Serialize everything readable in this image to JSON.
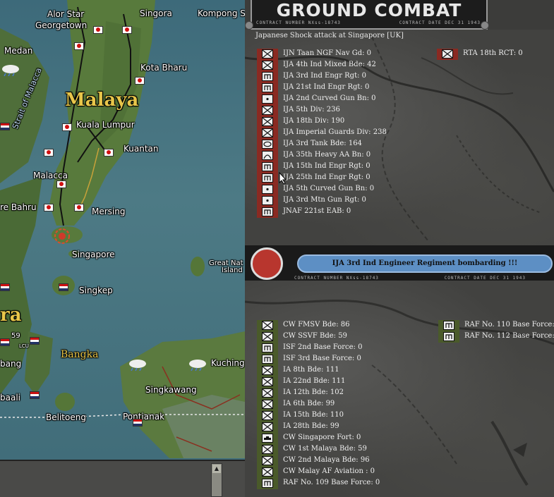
{
  "map": {
    "places": [
      {
        "name": "Alor Star",
        "cls": ""
      },
      {
        "name": "Georgetown",
        "cls": ""
      },
      {
        "name": "Singora",
        "cls": ""
      },
      {
        "name": "Kompong Sc",
        "cls": ""
      },
      {
        "name": "Medan",
        "cls": ""
      },
      {
        "name": "Kota Bharu",
        "cls": ""
      },
      {
        "name": "Malaya",
        "cls": "big"
      },
      {
        "name": "Kuala Lumpur",
        "cls": ""
      },
      {
        "name": "Kuantan",
        "cls": ""
      },
      {
        "name": "Malacca",
        "cls": ""
      },
      {
        "name": "re Bahru",
        "cls": ""
      },
      {
        "name": "Mersing",
        "cls": ""
      },
      {
        "name": "Singapore",
        "cls": ""
      },
      {
        "name": "Great Nat",
        "cls": "small"
      },
      {
        "name": "Island",
        "cls": "small"
      },
      {
        "name": "Singkep",
        "cls": ""
      },
      {
        "name": "ra",
        "cls": "big"
      },
      {
        "name": "Bangka",
        "cls": "yellow"
      },
      {
        "name": "Kuching",
        "cls": ""
      },
      {
        "name": "bang",
        "cls": ""
      },
      {
        "name": "Singkawang",
        "cls": ""
      },
      {
        "name": "baali",
        "cls": ""
      },
      {
        "name": "Belitoeng",
        "cls": ""
      },
      {
        "name": "Pontianak",
        "cls": ""
      },
      {
        "name": "Strait of Malacca",
        "cls": "blue"
      },
      {
        "name": "LCU",
        "cls": "small"
      },
      {
        "name": "59",
        "cls": "small"
      }
    ]
  },
  "header": {
    "title": "GROUND COMBAT",
    "contract_number": "CONTRACT NUMBER  NXss-18743",
    "contract_date": "CONTRACT DATE  DEC  31  1943"
  },
  "attack_desc": "Japanese Shock attack at Singapore [UK]",
  "attackers": [
    {
      "name": "IJN Taan NGF Nav Gd: 0",
      "icon": "infantry"
    },
    {
      "name": "IJA 4th Ind Mixed Bde: 42",
      "icon": "infantry"
    },
    {
      "name": "IJA 3rd Ind Engr Rgt: 0",
      "icon": "engineer"
    },
    {
      "name": "IJA 21st Ind Engr Rgt: 0",
      "icon": "engineer"
    },
    {
      "name": "IJA 2nd Curved Gun Bn: 0",
      "icon": "artillery"
    },
    {
      "name": "IJA 5th Div: 236",
      "icon": "infantry"
    },
    {
      "name": "IJA 18th Div: 190",
      "icon": "infantry"
    },
    {
      "name": "IJA Imperial Guards Div: 238",
      "icon": "infantry"
    },
    {
      "name": "IJA 3rd Tank Bde: 164",
      "icon": "armor"
    },
    {
      "name": "IJA 35th Heavy AA Bn: 0",
      "icon": "aa"
    },
    {
      "name": "IJA 15th Ind Engr Rgt: 0",
      "icon": "engineer"
    },
    {
      "name": "IJA 25th Ind Engr Rgt: 0",
      "icon": "engineer"
    },
    {
      "name": "IJA 5th Curved Gun Bn: 0",
      "icon": "artillery"
    },
    {
      "name": "IJA 3rd Mtn Gun Rgt: 0",
      "icon": "artillery"
    },
    {
      "name": "JNAF 221st EAB: 0",
      "icon": "engineer"
    }
  ],
  "attackers_right": [
    {
      "name": "RTA 18th RCT: 0",
      "icon": "infantry"
    }
  ],
  "banner": {
    "text": "IJA 3rd Ind Engineer Regiment bombarding !!!",
    "contract_number": "CONTRACT NUMBER  NXss-18743",
    "contract_date": "CONTRACT DATE  DEC  31  1943"
  },
  "defenders": [
    {
      "name": "CW FMSV Bde: 86",
      "icon": "infantry"
    },
    {
      "name": "CW SSVF Bde: 59",
      "icon": "infantry"
    },
    {
      "name": "ISF 2nd Base Force: 0",
      "icon": "engineer"
    },
    {
      "name": "ISF 3rd Base Force: 0",
      "icon": "engineer"
    },
    {
      "name": "IA 8th Bde: 111",
      "icon": "infantry"
    },
    {
      "name": "IA 22nd Bde: 111",
      "icon": "infantry"
    },
    {
      "name": "IA 12th Bde: 102",
      "icon": "infantry"
    },
    {
      "name": "IA 6th Bde: 99",
      "icon": "infantry"
    },
    {
      "name": "IA 15th Bde: 110",
      "icon": "infantry"
    },
    {
      "name": "IA 28th Bde: 99",
      "icon": "infantry"
    },
    {
      "name": "CW Singapore Fort: 0",
      "icon": "fort"
    },
    {
      "name": "CW 1st Malaya Bde: 59",
      "icon": "infantry"
    },
    {
      "name": "CW 2nd Malaya Bde: 96",
      "icon": "infantry"
    },
    {
      "name": "CW Malay AF Aviation : 0",
      "icon": "infantry"
    },
    {
      "name": "RAF No. 109 Base Force: 0",
      "icon": "engineer"
    }
  ],
  "defenders_right": [
    {
      "name": "RAF No. 110 Base Force: 0",
      "icon": "engineer"
    },
    {
      "name": "RAF No. 112 Base Force: 0",
      "icon": "engineer"
    }
  ],
  "colors": {
    "japan": "#8a2a22",
    "allied": "#4a5a2a",
    "banner": "#5d8fc4"
  }
}
